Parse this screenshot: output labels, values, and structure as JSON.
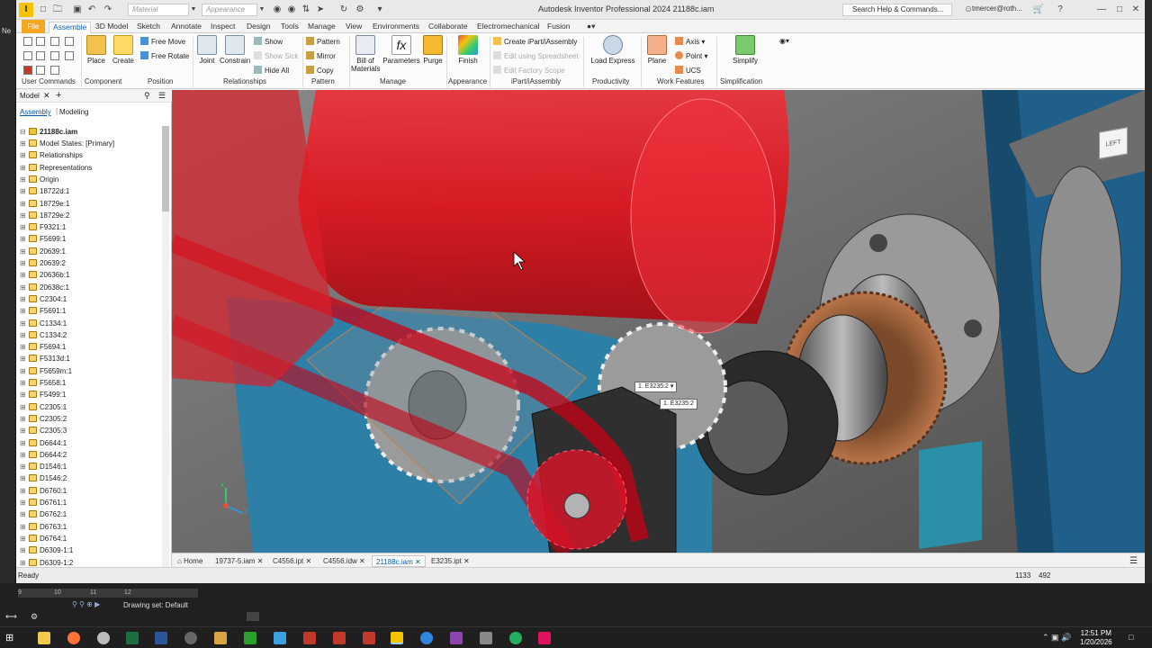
{
  "left_sliver": {
    "text": "Ne"
  },
  "titlebar": {
    "material_placeholder": "Material",
    "appearance_placeholder": "Appearance",
    "app_title": "Autodesk Inventor Professional 2024    21188c.iam",
    "search_placeholder": "Search Help & Commands...",
    "user": "tmercer@roth..."
  },
  "ribbon_tabs": [
    "File",
    "Assemble",
    "3D Model",
    "Sketch",
    "Annotate",
    "Inspect",
    "Design",
    "Tools",
    "Manage",
    "View",
    "Environments",
    "Collaborate",
    "Electromechanical",
    "Fusion"
  ],
  "ribbon": {
    "place": "Place",
    "create": "Create",
    "free_move": "Free Move",
    "free_rotate": "Free Rotate",
    "joint": "Joint",
    "constrain": "Constrain",
    "show": "Show",
    "show_sick": "Show Sick",
    "hide_all": "Hide All",
    "pattern": "Pattern",
    "mirror": "Mirror",
    "copy": "Copy",
    "bom": "Bill of Materials",
    "parameters": "Parameters",
    "purge": "Purge",
    "finish": "Finish",
    "create_ipart": "Create iPart/iAssembly",
    "edit_spreadsheet": "Edit using Spreadsheet",
    "edit_factory": "Edit Factory Scope",
    "load_express": "Load Express",
    "plane": "Plane",
    "axis": "Axis",
    "point": "Point",
    "ucs": "UCS",
    "simplify": "Simplify",
    "groups": {
      "user_commands": "User Commands",
      "component": "Component",
      "position": "Position",
      "relationships": "Relationships",
      "pattern": "Pattern",
      "manage": "Manage",
      "appearance": "Appearance",
      "ipart": "iPart/iAssembly",
      "productivity": "Productivity",
      "work_features": "Work Features",
      "simplification": "Simplification"
    }
  },
  "browser": {
    "tab": "Model",
    "sub_assembly": "Assembly",
    "sub_modeling": "Modeling",
    "root": "21188c.iam",
    "items": [
      "Model States: [Primary]",
      "Relationships",
      "Representations",
      "Origin",
      "18722d:1",
      "18729e:1",
      "18729e:2",
      "F9321:1",
      "F5699:1",
      "20639:1",
      "20639:2",
      "20636b:1",
      "20638c:1",
      "C2304:1",
      "F5691:1",
      "C1334:1",
      "C1334:2",
      "F5694:1",
      "F5313d:1",
      "F5659m:1",
      "F5658:1",
      "F5499:1",
      "C2305:1",
      "C2305:2",
      "C2305:3",
      "D6644:1",
      "D6644:2",
      "D1546:1",
      "D1546:2",
      "D6760:1",
      "D6761:1",
      "D6762:1",
      "D6763:1",
      "D6764:1",
      "D6309-1:1",
      "D6309-1:2"
    ]
  },
  "viewport": {
    "viewcube_label": "LEFT",
    "tag1": "1. E3235:2",
    "tag2": "1. E3235:2",
    "coord_x": "x",
    "coord_z": "z"
  },
  "doc_tabs": [
    "Home",
    "19737-5.iam",
    "C4556.ipt",
    "C4556.idw",
    "21188c.iam",
    "E3235.ipt"
  ],
  "status": {
    "text": "Ready",
    "num1": "1133",
    "num2": "492"
  },
  "below": {
    "timeline": [
      "9",
      "10",
      "11",
      "12"
    ],
    "drawing_set": "Drawing set: Default"
  },
  "taskbar": {
    "time": "12:51 PM",
    "date": "1/20/2026"
  },
  "colors": {
    "ribbon_accent": "#0a5aa8",
    "file_tab": "#f5a623",
    "red_housing": "#e0101a",
    "blue_frame": "#1f5f8a"
  }
}
